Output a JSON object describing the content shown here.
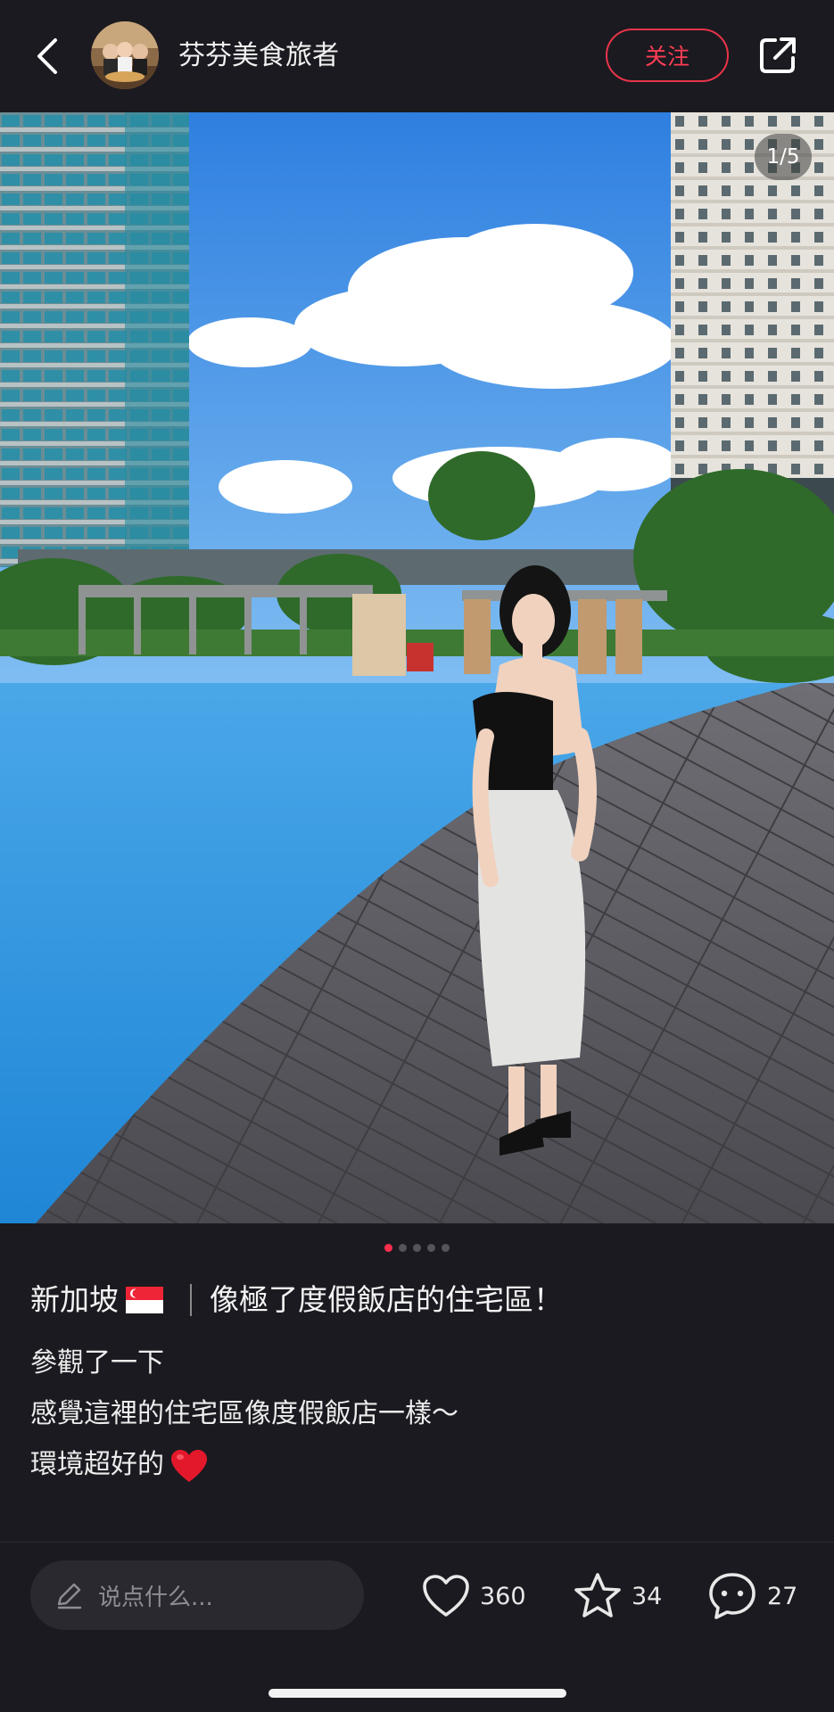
{
  "header": {
    "back_icon": "chevron-left-icon",
    "author_name": "芬芬美食旅者",
    "follow_label": "关注",
    "share_icon": "share-external-icon"
  },
  "photo": {
    "counter": "1/5",
    "page_count": 5,
    "current_page": 1
  },
  "post": {
    "title_left": "新加坡",
    "title_flag": "singapore-flag-emoji",
    "title_right": "像極了度假飯店的住宅區！",
    "body": [
      "參觀了一下",
      "感覺這裡的住宅區像度假飯店一樣～",
      "環境超好的"
    ],
    "body_emoji": "red-heart-emoji"
  },
  "bottom_bar": {
    "comment_placeholder": "说点什么...",
    "likes": "360",
    "collects": "34",
    "comments": "27"
  },
  "colors": {
    "background": "#1b1a20",
    "accent_red": "#ff2e4d",
    "input_bg": "#2a2930"
  }
}
